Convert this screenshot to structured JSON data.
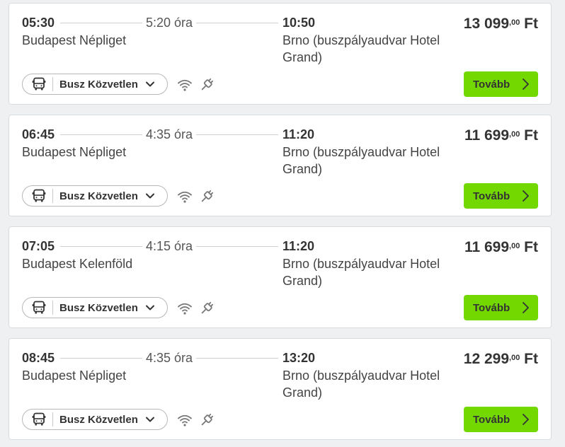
{
  "currency": "Ft",
  "colors": {
    "accent": "#73d700",
    "card_background": "#ffffff",
    "page_background": "#eef0f2",
    "text": "#333333"
  },
  "trips": [
    {
      "departure_time": "05:30",
      "duration": "5:20 óra",
      "arrival_time": "10:50",
      "departure_station": "Budapest Népliget",
      "arrival_station": "Brno (buszpályaudvar Hotel Grand)",
      "price_main": "13 099",
      "price_decimals": ",00",
      "mode_label": "Busz Közvetlen",
      "mode_icon": "bus-icon",
      "amenities": [
        "wifi-icon",
        "power-plug-icon"
      ],
      "button_label": "Tovább"
    },
    {
      "departure_time": "06:45",
      "duration": "4:35 óra",
      "arrival_time": "11:20",
      "departure_station": "Budapest Népliget",
      "arrival_station": "Brno (buszpályaudvar Hotel Grand)",
      "price_main": "11 699",
      "price_decimals": ",00",
      "mode_label": "Busz Közvetlen",
      "mode_icon": "bus-icon",
      "amenities": [
        "wifi-icon",
        "power-plug-icon"
      ],
      "button_label": "Tovább"
    },
    {
      "departure_time": "07:05",
      "duration": "4:15 óra",
      "arrival_time": "11:20",
      "departure_station": "Budapest Kelenföld",
      "arrival_station": "Brno (buszpályaudvar Hotel Grand)",
      "price_main": "11 699",
      "price_decimals": ",00",
      "mode_label": "Busz Közvetlen",
      "mode_icon": "bus-icon",
      "amenities": [
        "wifi-icon",
        "power-plug-icon"
      ],
      "button_label": "Tovább"
    },
    {
      "departure_time": "08:45",
      "duration": "4:35 óra",
      "arrival_time": "13:20",
      "departure_station": "Budapest Népliget",
      "arrival_station": "Brno (buszpályaudvar Hotel Grand)",
      "price_main": "12 299",
      "price_decimals": ",00",
      "mode_label": "Busz Közvetlen",
      "mode_icon": "bus-icon",
      "amenities": [
        "wifi-icon",
        "power-plug-icon"
      ],
      "button_label": "Tovább"
    }
  ]
}
